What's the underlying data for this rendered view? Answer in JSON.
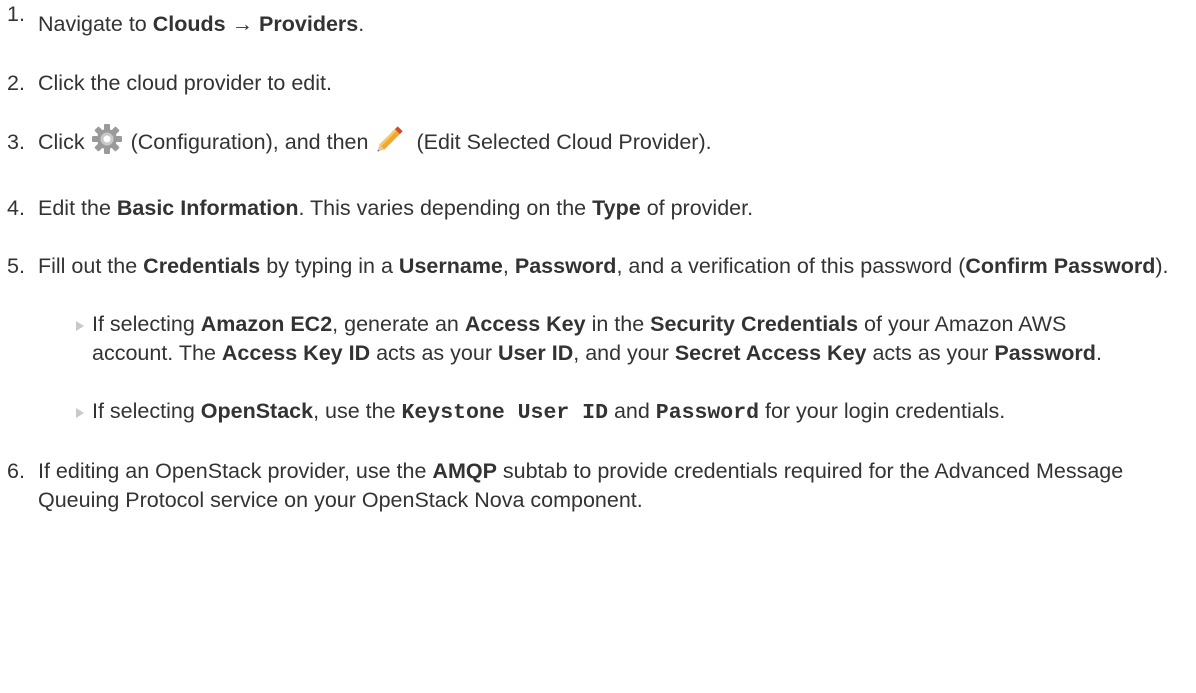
{
  "steps": [
    {
      "num": "1.",
      "text_1": "Navigate to ",
      "bold_1": "Clouds",
      "arrow": " → ",
      "bold_2": "Providers",
      "text_2": "."
    },
    {
      "num": "2.",
      "text_1": "Click the cloud provider to edit."
    },
    {
      "num": "3.",
      "text_1": "Click",
      "icon_1": "gear-icon",
      "text_2": "(Configuration), and then",
      "icon_2": "pencil-icon",
      "text_3": "(Edit Selected Cloud Provider)."
    },
    {
      "num": "4.",
      "text_1": "Edit the ",
      "bold_1": "Basic Information",
      "text_2": ". This varies depending on the ",
      "bold_2": "Type",
      "text_3": " of provider."
    },
    {
      "num": "5.",
      "text_1": "Fill out the ",
      "bold_1": "Credentials",
      "text_2": " by typing in a ",
      "bold_2": "Username",
      "text_3": ", ",
      "bold_3": "Password",
      "text_4": ", and a verification of this password (",
      "bold_4": "Confirm Password",
      "text_5": ").",
      "subitems": [
        {
          "text_1": "If selecting ",
          "bold_1": "Amazon EC2",
          "text_2": ", generate an ",
          "bold_2": "Access Key",
          "text_3": " in the ",
          "bold_3": "Security Credentials",
          "text_4": " of your Amazon AWS account. The ",
          "bold_4": "Access Key ID",
          "text_5": " acts as your ",
          "bold_5": "User ID",
          "text_6": ", and your ",
          "bold_6": "Secret Access Key",
          "text_7": " acts as your ",
          "bold_7": "Password",
          "text_8": "."
        },
        {
          "text_1": "If selecting ",
          "bold_1": "OpenStack",
          "text_2": ", use the ",
          "mono_1": "Keystone User ID",
          "text_3": " and ",
          "mono_2": "Password",
          "text_4": " for your login credentials."
        }
      ]
    },
    {
      "num": "6.",
      "text_1": "If editing an OpenStack provider, use the ",
      "bold_1": "AMQP",
      "text_2": " subtab to provide credentials required for the Advanced Message Queuing Protocol service on your OpenStack Nova component."
    }
  ],
  "colors": {
    "text": "#333333",
    "bullet": "#c9c9c9",
    "gear": "#9a9a9a",
    "pencil_body": "#f0a830",
    "pencil_tip": "#d24a2a"
  }
}
